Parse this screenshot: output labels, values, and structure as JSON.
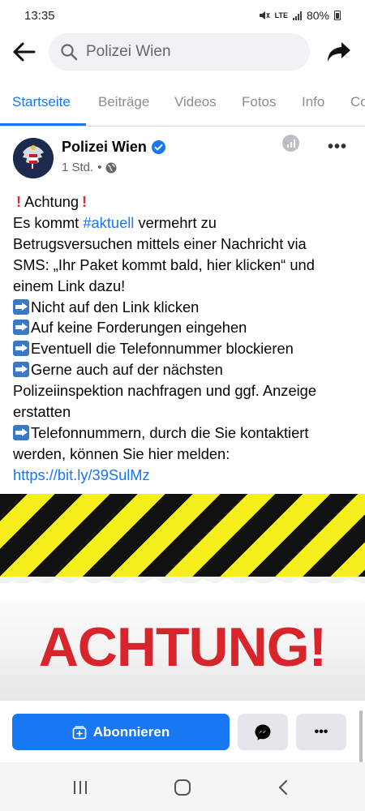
{
  "status_bar": {
    "time": "13:35",
    "network": "LTE",
    "battery": "80%"
  },
  "search": {
    "value": "Polizei Wien"
  },
  "tabs": [
    {
      "label": "Startseite",
      "active": true
    },
    {
      "label": "Beiträge",
      "active": false
    },
    {
      "label": "Videos",
      "active": false
    },
    {
      "label": "Fotos",
      "active": false
    },
    {
      "label": "Info",
      "active": false
    },
    {
      "label": "Co",
      "active": false
    }
  ],
  "post": {
    "page_name": "Polizei Wien",
    "time": "1 Std.",
    "dot": "•",
    "more": "•••",
    "lines": {
      "l1": "Achtung",
      "l2a": "Es kommt ",
      "hashtag": "#aktuell",
      "l2b": " vermehrt zu",
      "l3": "Betrugsversuchen mittels einer Nachricht via",
      "l4": "SMS: „Ihr Paket kommt bald, hier klicken“ und",
      "l5": "einem Link dazu!",
      "l6": "Nicht auf den Link klicken",
      "l7": "Auf keine Forderungen eingehen",
      "l8": "Eventuell die Telefonnummer blockieren",
      "l9": "Gerne auch auf der nächsten",
      "l10": "Polizeiinspektion nachfragen und ggf. Anzeige",
      "l11": "erstatten",
      "l12": "Telefonnummern, durch die Sie kontaktiert",
      "l13": "werden, können Sie hier melden:",
      "link": "https://bit.ly/39SulMz"
    },
    "image_text": "ACHTUNG!"
  },
  "actions": {
    "subscribe_label": "Abonnieren",
    "more_label": "•••"
  },
  "colors": {
    "accent": "#1877f2",
    "warning_red": "#d8242b",
    "stripe_yellow": "#f6ee1d"
  }
}
